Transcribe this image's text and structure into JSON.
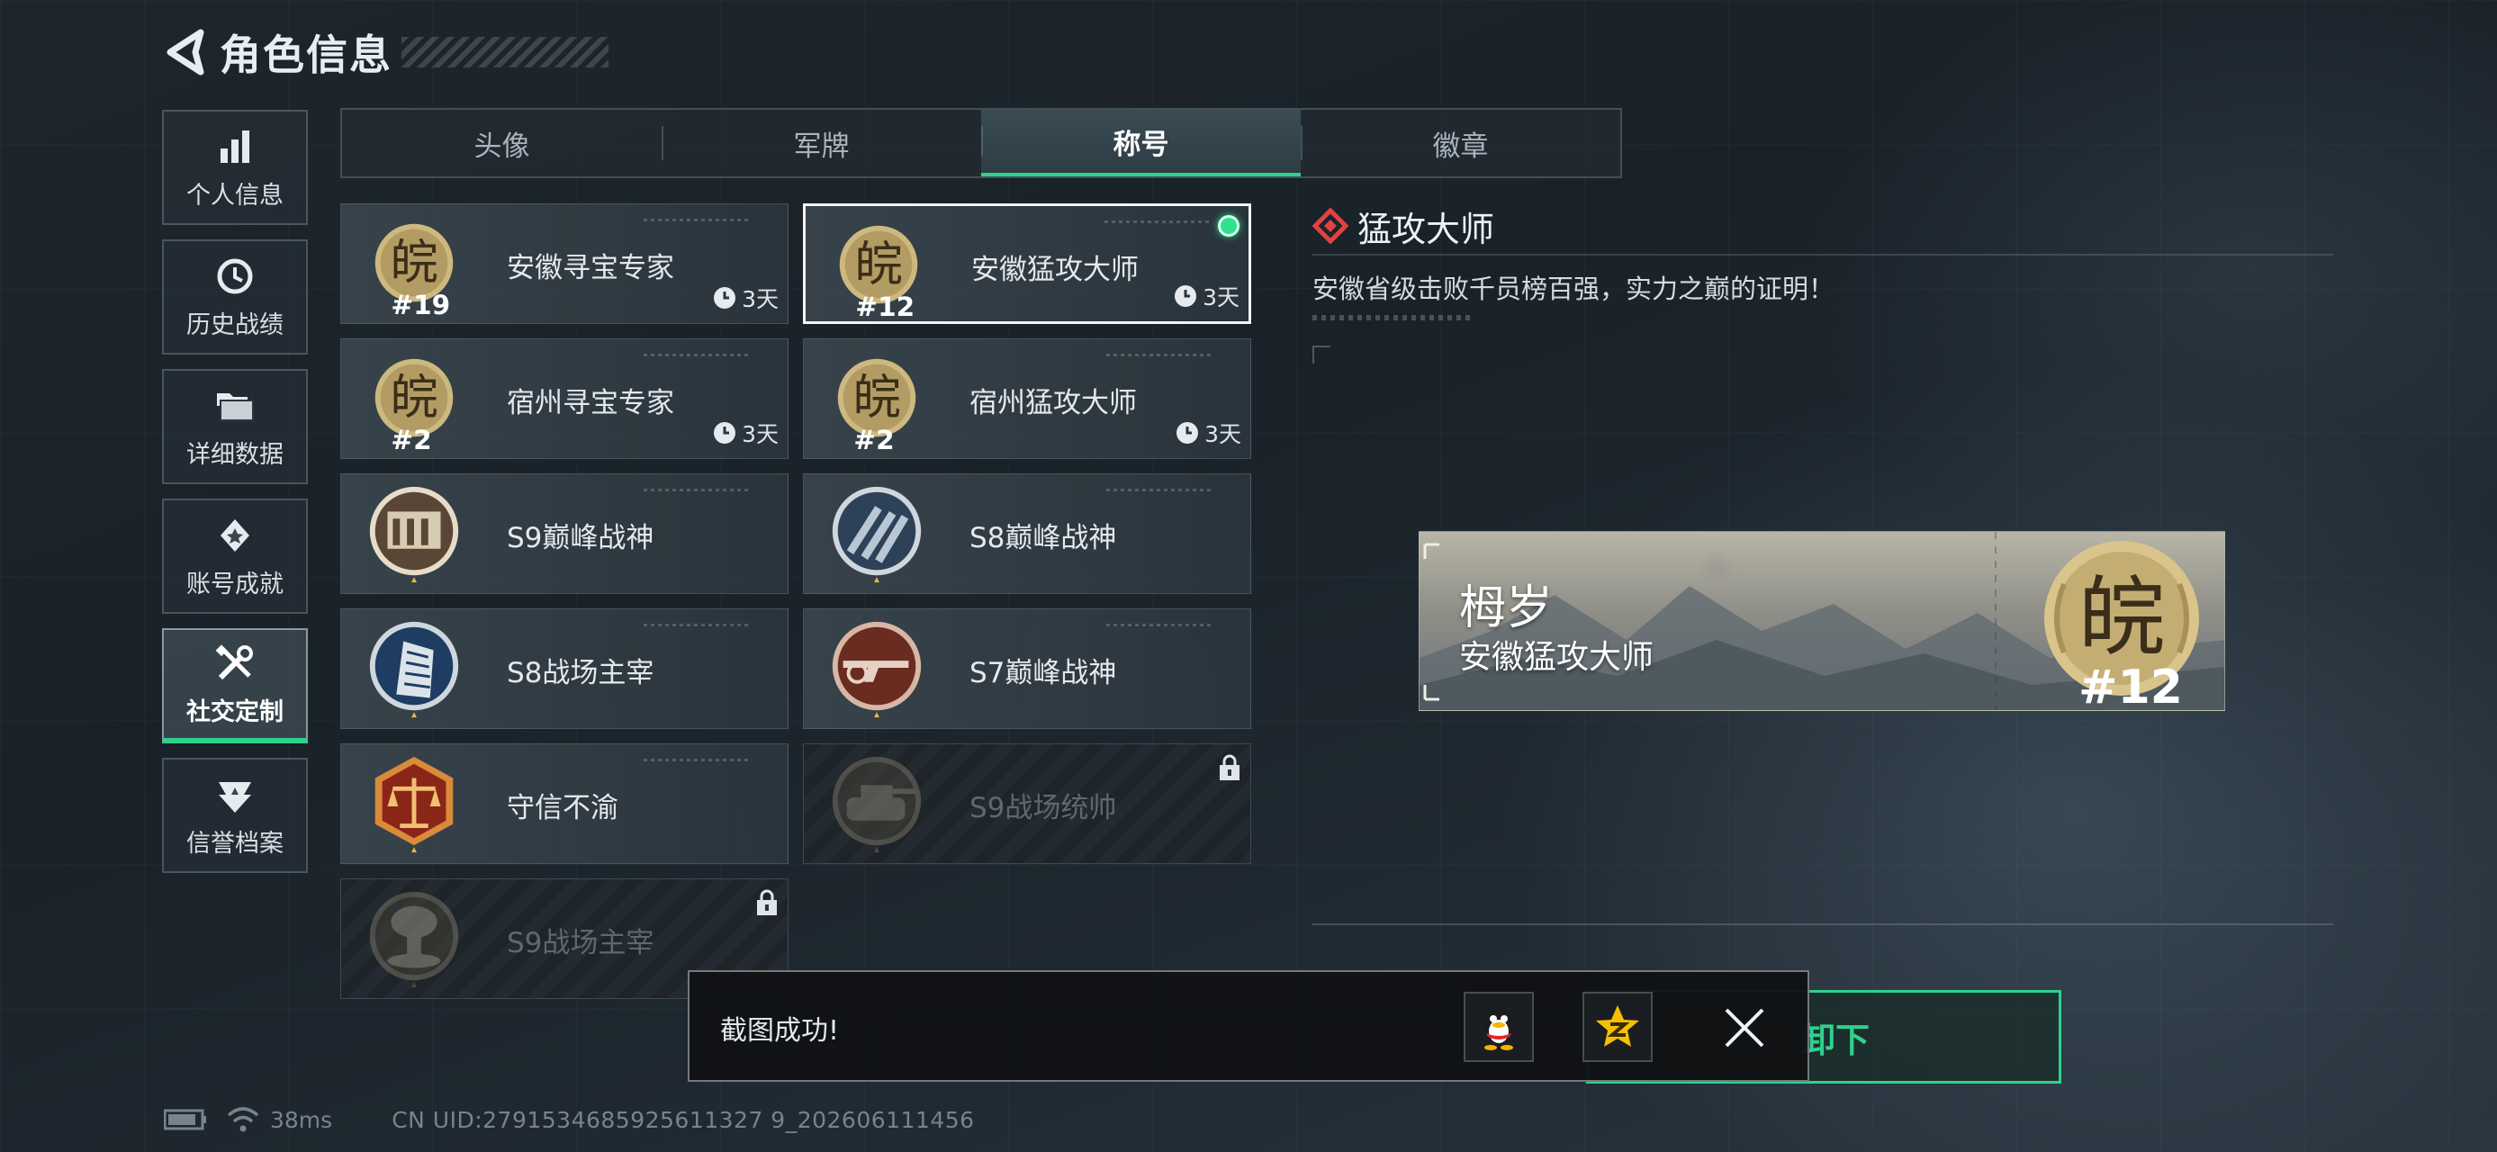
{
  "header": {
    "title": "角色信息"
  },
  "side_nav": {
    "items": [
      {
        "label": "个人信息",
        "icon": "bar-chart-icon",
        "active": false
      },
      {
        "label": "历史战绩",
        "icon": "history-clock-icon",
        "active": false
      },
      {
        "label": "详细数据",
        "icon": "folder-icon",
        "active": false
      },
      {
        "label": "账号成就",
        "icon": "medal-icon",
        "active": false
      },
      {
        "label": "社交定制",
        "icon": "tools-icon",
        "active": true
      },
      {
        "label": "信誉档案",
        "icon": "shield-icon",
        "active": false
      }
    ]
  },
  "tabs": [
    {
      "label": "头像",
      "active": false
    },
    {
      "label": "军牌",
      "active": false
    },
    {
      "label": "称号",
      "active": true
    },
    {
      "label": "徽章",
      "active": false
    }
  ],
  "titles": [
    {
      "name": "安徽寻宝专家",
      "emblem": "wan-gold-emblem",
      "rank": "#19",
      "timer": "3天",
      "locked": false,
      "selected": false,
      "equipped": false
    },
    {
      "name": "安徽猛攻大师",
      "emblem": "wan-gold-emblem",
      "rank": "#12",
      "timer": "3天",
      "locked": false,
      "selected": true,
      "equipped": true
    },
    {
      "name": "宿州寻宝专家",
      "emblem": "wan-gold-emblem",
      "rank": "#2",
      "timer": "3天",
      "locked": false,
      "selected": false,
      "equipped": false
    },
    {
      "name": "宿州猛攻大师",
      "emblem": "wan-gold-emblem",
      "rank": "#2",
      "timer": "3天",
      "locked": false,
      "selected": false,
      "equipped": false
    },
    {
      "name": "S9巅峰战神",
      "emblem": "building-emblem",
      "locked": false
    },
    {
      "name": "S8巅峰战神",
      "emblem": "stripes-emblem",
      "locked": false
    },
    {
      "name": "S8战场主宰",
      "emblem": "tower-emblem",
      "locked": false
    },
    {
      "name": "S7巅峰战神",
      "emblem": "rifle-emblem",
      "locked": false
    },
    {
      "name": "守信不渝",
      "emblem": "scales-emblem",
      "locked": false
    },
    {
      "name": "S9战场统帅",
      "emblem": "tank-emblem",
      "locked": true
    },
    {
      "name": "S9战场主宰",
      "emblem": "explosion-emblem",
      "locked": true
    }
  ],
  "detail": {
    "title": "猛攻大师",
    "description": "安徽省级击败千员榜百强，实力之巅的证明！"
  },
  "preview": {
    "player_name": "栂岁",
    "title": "安徽猛攻大师",
    "rank": "#12"
  },
  "unequip_button": {
    "label": "卸下"
  },
  "toast": {
    "message": "截图成功!"
  },
  "status_bar": {
    "ping": "38ms",
    "uid": "CN UID:2791534685925611327 9_202606111456"
  },
  "colors": {
    "accent_green": "#2fd18c",
    "equipped_dot": "#2fe08f",
    "gold": "#cdb87f",
    "diamond_red": "#e0433f"
  }
}
